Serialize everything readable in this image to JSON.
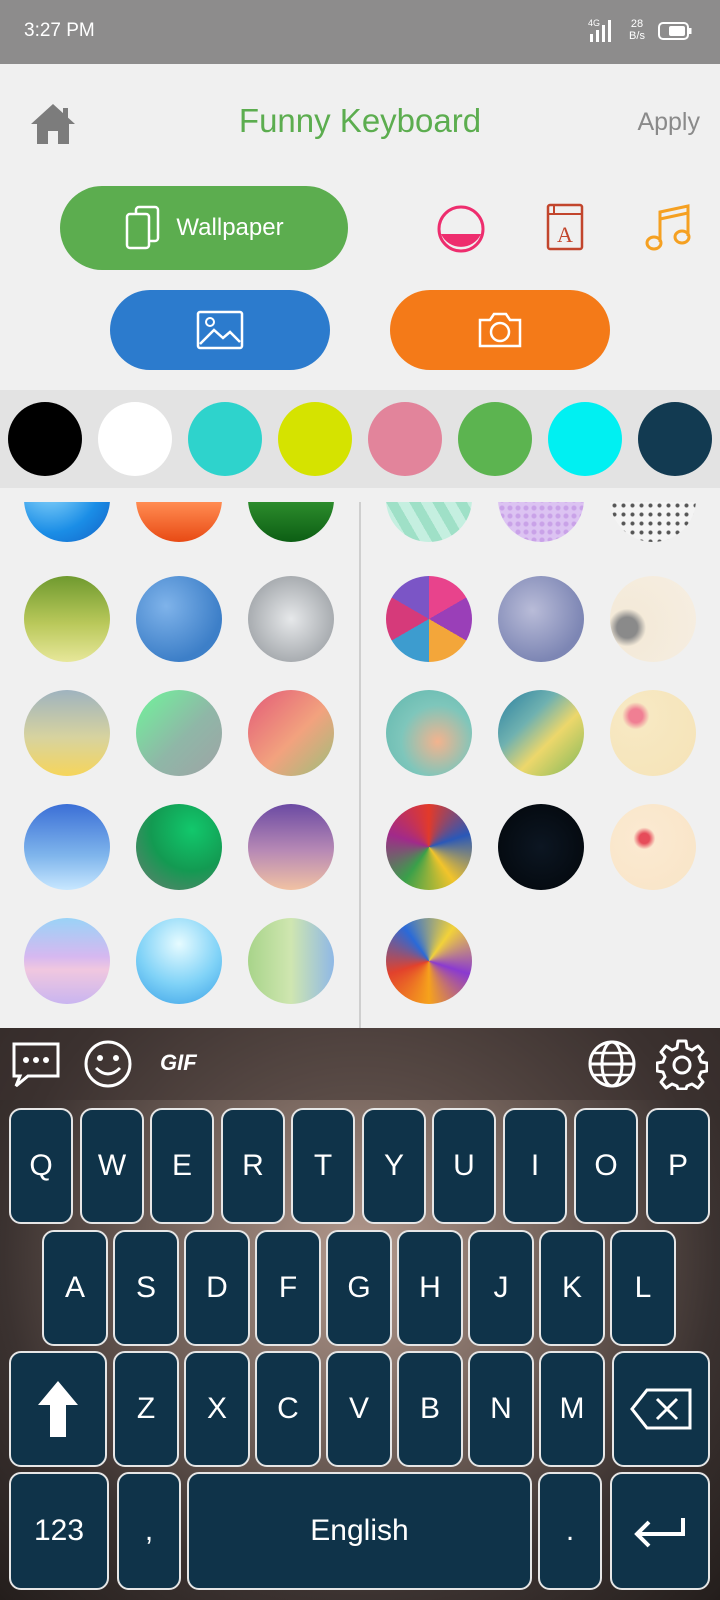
{
  "status": {
    "time": "3:27 PM",
    "net_speed_value": "28",
    "net_speed_unit": "B/s"
  },
  "header": {
    "title": "Funny Keyboard",
    "apply": "Apply"
  },
  "buttons": {
    "wallpaper": "Wallpaper"
  },
  "colors": [
    "#000000",
    "#ffffff",
    "#2ed3cc",
    "#d5e300",
    "#e2849b",
    "#5cb450",
    "#00f0f2",
    "#123a51"
  ],
  "keyboard": {
    "toolbar": {
      "gif": "GIF"
    },
    "row1": [
      "Q",
      "W",
      "E",
      "R",
      "T",
      "Y",
      "U",
      "I",
      "O",
      "P"
    ],
    "row2": [
      "A",
      "S",
      "D",
      "F",
      "G",
      "H",
      "J",
      "K",
      "L"
    ],
    "row3": [
      "Z",
      "X",
      "C",
      "V",
      "B",
      "N",
      "M"
    ],
    "bottom": {
      "numbers": "123",
      "comma": ",",
      "space": "English",
      "period": "."
    }
  },
  "accent_colors": {
    "green": "#5cad4f",
    "blue": "#2c7bcd",
    "orange": "#f47a18",
    "key": "#0f3349"
  }
}
